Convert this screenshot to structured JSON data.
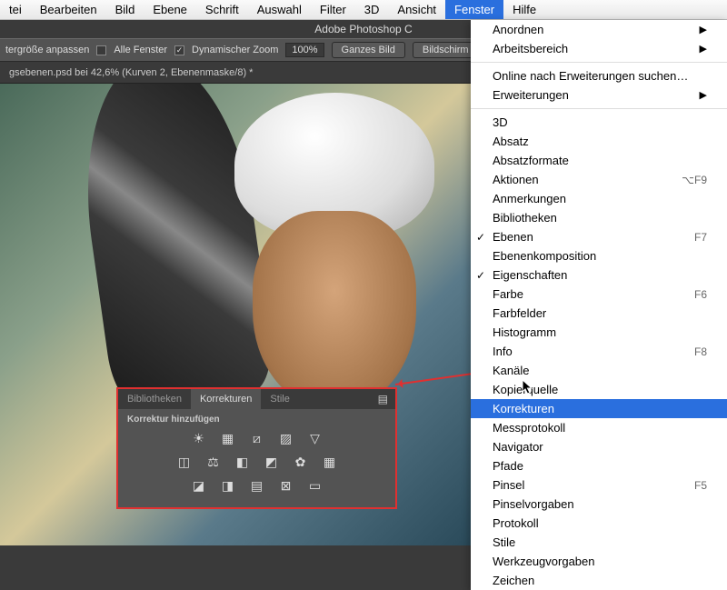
{
  "menubar": {
    "items": [
      "tei",
      "Bearbeiten",
      "Bild",
      "Ebene",
      "Schrift",
      "Auswahl",
      "Filter",
      "3D",
      "Ansicht",
      "Fenster",
      "Hilfe"
    ],
    "active_index": 9
  },
  "app_title": "Adobe Photoshop C",
  "options_bar": {
    "label_resize": "tergröße anpassen",
    "chk_all_windows": {
      "checked": false,
      "label": "Alle Fenster"
    },
    "chk_dyn_zoom": {
      "checked": true,
      "label": "Dynamischer Zoom"
    },
    "zoom_value": "100%",
    "btn_fit": "Ganzes Bild",
    "btn_screen": "Bildschirm"
  },
  "document_tab": "gsebenen.psd bei 42,6% (Kurven 2, Ebenenmaske/8) *",
  "dropdown": {
    "groups": [
      [
        {
          "label": "Anordnen",
          "submenu": true
        },
        {
          "label": "Arbeitsbereich",
          "submenu": true
        }
      ],
      [
        {
          "label": "Online nach Erweiterungen suchen…"
        },
        {
          "label": "Erweiterungen",
          "submenu": true
        }
      ],
      [
        {
          "label": "3D"
        },
        {
          "label": "Absatz"
        },
        {
          "label": "Absatzformate"
        },
        {
          "label": "Aktionen",
          "shortcut": "⌥F9"
        },
        {
          "label": "Anmerkungen"
        },
        {
          "label": "Bibliotheken"
        },
        {
          "label": "Ebenen",
          "checked": true,
          "shortcut": "F7"
        },
        {
          "label": "Ebenenkomposition"
        },
        {
          "label": "Eigenschaften",
          "checked": true
        },
        {
          "label": "Farbe",
          "shortcut": "F6"
        },
        {
          "label": "Farbfelder"
        },
        {
          "label": "Histogramm"
        },
        {
          "label": "Info",
          "shortcut": "F8"
        },
        {
          "label": "Kanäle"
        },
        {
          "label": "Kopierquelle"
        },
        {
          "label": "Korrekturen",
          "highlighted": true
        },
        {
          "label": "Messprotokoll"
        },
        {
          "label": "Navigator"
        },
        {
          "label": "Pfade"
        },
        {
          "label": "Pinsel",
          "shortcut": "F5"
        },
        {
          "label": "Pinselvorgaben"
        },
        {
          "label": "Protokoll"
        },
        {
          "label": "Stile"
        },
        {
          "label": "Werkzeugvorgaben"
        },
        {
          "label": "Zeichen"
        }
      ]
    ]
  },
  "panel": {
    "tabs": [
      "Bibliotheken",
      "Korrekturen",
      "Stile"
    ],
    "active_tab_index": 1,
    "heading": "Korrektur hinzufügen",
    "icon_rows": [
      [
        "brightness",
        "levels",
        "curves",
        "exposure",
        "vibrance"
      ],
      [
        "hue",
        "colorbalance",
        "bw",
        "photofilter",
        "channelmixer",
        "colorlookup"
      ],
      [
        "invert",
        "posterize",
        "threshold",
        "selective",
        "gradientmap"
      ]
    ],
    "icon_glyphs": {
      "brightness": "☀",
      "levels": "▦",
      "curves": "⧄",
      "exposure": "▨",
      "vibrance": "▽",
      "hue": "◫",
      "colorbalance": "⚖",
      "bw": "◧",
      "photofilter": "◩",
      "channelmixer": "✿",
      "colorlookup": "▦",
      "invert": "◪",
      "posterize": "◨",
      "threshold": "▤",
      "selective": "⊠",
      "gradientmap": "▭"
    }
  }
}
